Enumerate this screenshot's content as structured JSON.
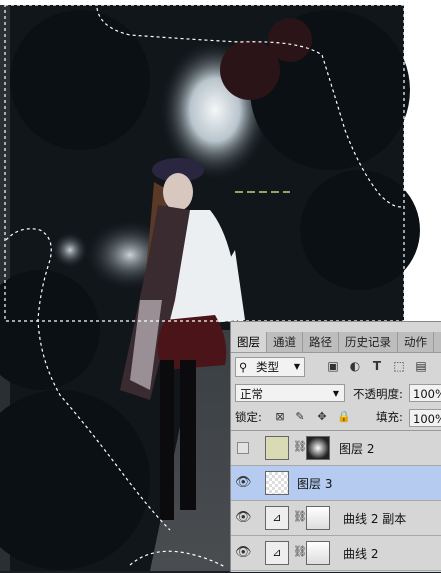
{
  "tabs": [
    "图层",
    "通道",
    "路径",
    "历史记录",
    "动作"
  ],
  "filter_kind": "类型",
  "filter_icons": [
    "image-filter-icon",
    "adjustment-filter-icon",
    "type-filter-icon",
    "shape-filter-icon",
    "smart-object-filter-icon"
  ],
  "blend_mode": "正常",
  "opacity_label": "不透明度:",
  "opacity_value": "100%",
  "lock_label": "锁定:",
  "fill_label": "填充:",
  "fill_value": "100%",
  "layers": [
    {
      "name": "图层 2",
      "visible": false,
      "selected": false
    },
    {
      "name": "图层 3",
      "visible": true,
      "selected": true
    },
    {
      "name": "曲线 2 副本",
      "visible": true,
      "selected": false
    },
    {
      "name": "曲线 2",
      "visible": true,
      "selected": false
    }
  ],
  "colors": {
    "panel_bg": "#d6d6d6",
    "selected_layer": "#b5cbef",
    "layer2_fill": "#d9dbb5"
  }
}
